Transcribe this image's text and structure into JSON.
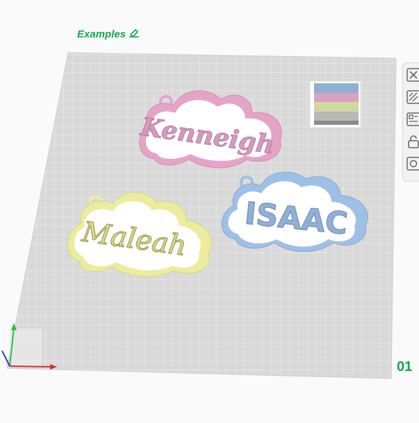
{
  "plate": {
    "label": "Examples",
    "number": "01"
  },
  "models": [
    {
      "text": "Kenneigh",
      "color": "#e6a3c8"
    },
    {
      "text": "ISAAC",
      "color": "#9ec0e6"
    },
    {
      "text": "Maleah",
      "color": "#ecec9e"
    }
  ],
  "toolbar": {
    "icons": [
      "close-icon",
      "arrange-icon",
      "layout-icon",
      "lock-icon",
      "view-icon"
    ]
  },
  "colors": {
    "accent": "#12a84a",
    "bed": "#d9d9d9",
    "pink": "#e6a3c8",
    "blue": "#9ec0e6",
    "yellow": "#ecec9e"
  }
}
